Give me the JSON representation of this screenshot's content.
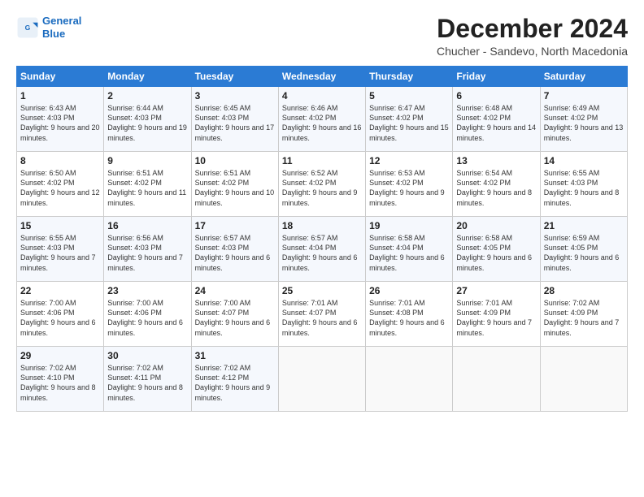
{
  "header": {
    "logo_line1": "General",
    "logo_line2": "Blue",
    "month_title": "December 2024",
    "subtitle": "Chucher - Sandevo, North Macedonia"
  },
  "days_of_week": [
    "Sunday",
    "Monday",
    "Tuesday",
    "Wednesday",
    "Thursday",
    "Friday",
    "Saturday"
  ],
  "weeks": [
    [
      {
        "day": "1",
        "sunrise": "6:43 AM",
        "sunset": "4:03 PM",
        "daylight": "9 hours and 20 minutes."
      },
      {
        "day": "2",
        "sunrise": "6:44 AM",
        "sunset": "4:03 PM",
        "daylight": "9 hours and 19 minutes."
      },
      {
        "day": "3",
        "sunrise": "6:45 AM",
        "sunset": "4:03 PM",
        "daylight": "9 hours and 17 minutes."
      },
      {
        "day": "4",
        "sunrise": "6:46 AM",
        "sunset": "4:02 PM",
        "daylight": "9 hours and 16 minutes."
      },
      {
        "day": "5",
        "sunrise": "6:47 AM",
        "sunset": "4:02 PM",
        "daylight": "9 hours and 15 minutes."
      },
      {
        "day": "6",
        "sunrise": "6:48 AM",
        "sunset": "4:02 PM",
        "daylight": "9 hours and 14 minutes."
      },
      {
        "day": "7",
        "sunrise": "6:49 AM",
        "sunset": "4:02 PM",
        "daylight": "9 hours and 13 minutes."
      }
    ],
    [
      {
        "day": "8",
        "sunrise": "6:50 AM",
        "sunset": "4:02 PM",
        "daylight": "9 hours and 12 minutes."
      },
      {
        "day": "9",
        "sunrise": "6:51 AM",
        "sunset": "4:02 PM",
        "daylight": "9 hours and 11 minutes."
      },
      {
        "day": "10",
        "sunrise": "6:51 AM",
        "sunset": "4:02 PM",
        "daylight": "9 hours and 10 minutes."
      },
      {
        "day": "11",
        "sunrise": "6:52 AM",
        "sunset": "4:02 PM",
        "daylight": "9 hours and 9 minutes."
      },
      {
        "day": "12",
        "sunrise": "6:53 AM",
        "sunset": "4:02 PM",
        "daylight": "9 hours and 9 minutes."
      },
      {
        "day": "13",
        "sunrise": "6:54 AM",
        "sunset": "4:02 PM",
        "daylight": "9 hours and 8 minutes."
      },
      {
        "day": "14",
        "sunrise": "6:55 AM",
        "sunset": "4:03 PM",
        "daylight": "9 hours and 8 minutes."
      }
    ],
    [
      {
        "day": "15",
        "sunrise": "6:55 AM",
        "sunset": "4:03 PM",
        "daylight": "9 hours and 7 minutes."
      },
      {
        "day": "16",
        "sunrise": "6:56 AM",
        "sunset": "4:03 PM",
        "daylight": "9 hours and 7 minutes."
      },
      {
        "day": "17",
        "sunrise": "6:57 AM",
        "sunset": "4:03 PM",
        "daylight": "9 hours and 6 minutes."
      },
      {
        "day": "18",
        "sunrise": "6:57 AM",
        "sunset": "4:04 PM",
        "daylight": "9 hours and 6 minutes."
      },
      {
        "day": "19",
        "sunrise": "6:58 AM",
        "sunset": "4:04 PM",
        "daylight": "9 hours and 6 minutes."
      },
      {
        "day": "20",
        "sunrise": "6:58 AM",
        "sunset": "4:05 PM",
        "daylight": "9 hours and 6 minutes."
      },
      {
        "day": "21",
        "sunrise": "6:59 AM",
        "sunset": "4:05 PM",
        "daylight": "9 hours and 6 minutes."
      }
    ],
    [
      {
        "day": "22",
        "sunrise": "7:00 AM",
        "sunset": "4:06 PM",
        "daylight": "9 hours and 6 minutes."
      },
      {
        "day": "23",
        "sunrise": "7:00 AM",
        "sunset": "4:06 PM",
        "daylight": "9 hours and 6 minutes."
      },
      {
        "day": "24",
        "sunrise": "7:00 AM",
        "sunset": "4:07 PM",
        "daylight": "9 hours and 6 minutes."
      },
      {
        "day": "25",
        "sunrise": "7:01 AM",
        "sunset": "4:07 PM",
        "daylight": "9 hours and 6 minutes."
      },
      {
        "day": "26",
        "sunrise": "7:01 AM",
        "sunset": "4:08 PM",
        "daylight": "9 hours and 6 minutes."
      },
      {
        "day": "27",
        "sunrise": "7:01 AM",
        "sunset": "4:09 PM",
        "daylight": "9 hours and 7 minutes."
      },
      {
        "day": "28",
        "sunrise": "7:02 AM",
        "sunset": "4:09 PM",
        "daylight": "9 hours and 7 minutes."
      }
    ],
    [
      {
        "day": "29",
        "sunrise": "7:02 AM",
        "sunset": "4:10 PM",
        "daylight": "9 hours and 8 minutes."
      },
      {
        "day": "30",
        "sunrise": "7:02 AM",
        "sunset": "4:11 PM",
        "daylight": "9 hours and 8 minutes."
      },
      {
        "day": "31",
        "sunrise": "7:02 AM",
        "sunset": "4:12 PM",
        "daylight": "9 hours and 9 minutes."
      },
      null,
      null,
      null,
      null
    ]
  ]
}
